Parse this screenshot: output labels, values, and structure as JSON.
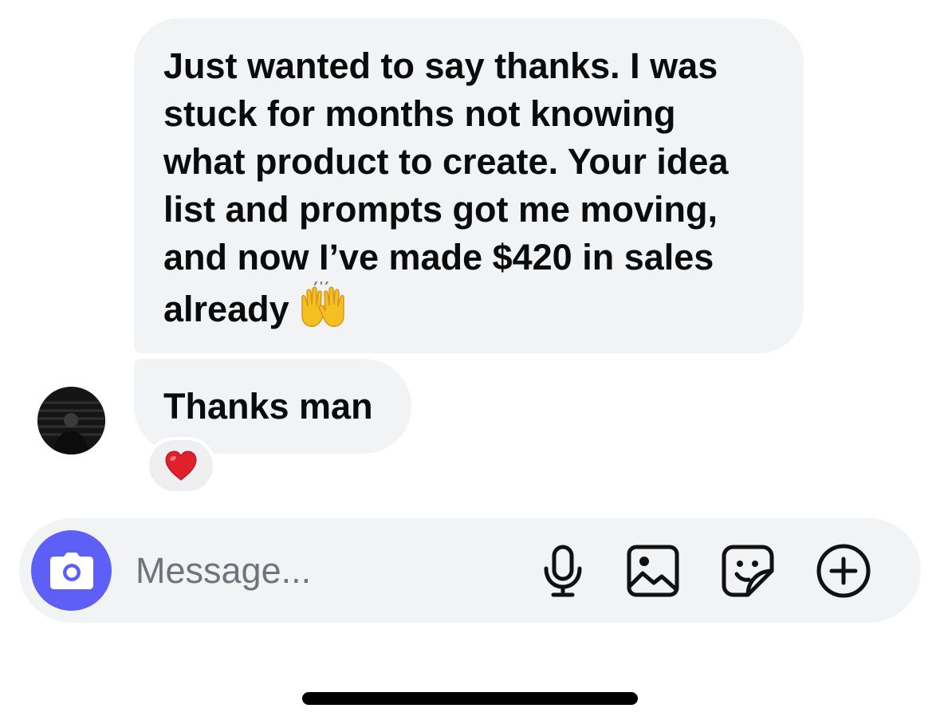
{
  "conversation": {
    "messages": [
      {
        "lines": [
          "Just wanted to say thanks. I was",
          "stuck for months not knowing",
          "what product to create. Your idea",
          "list and prompts got me moving,",
          "and now I’ve made $420 in sales",
          "already"
        ],
        "emoji": "raising-hands-emoji"
      },
      {
        "text": "Thanks man",
        "reaction": "red-heart-emoji"
      }
    ]
  },
  "composer": {
    "placeholder": "Message...",
    "buttons": [
      "camera-icon",
      "microphone-icon",
      "gallery-icon",
      "sticker-icon",
      "add-icon"
    ]
  },
  "colors": {
    "bubble_background": "#f2f3f5",
    "camera_button": "#5d5ff7",
    "placeholder_text": "#6f737b",
    "reaction_heart": "#e0202b"
  }
}
